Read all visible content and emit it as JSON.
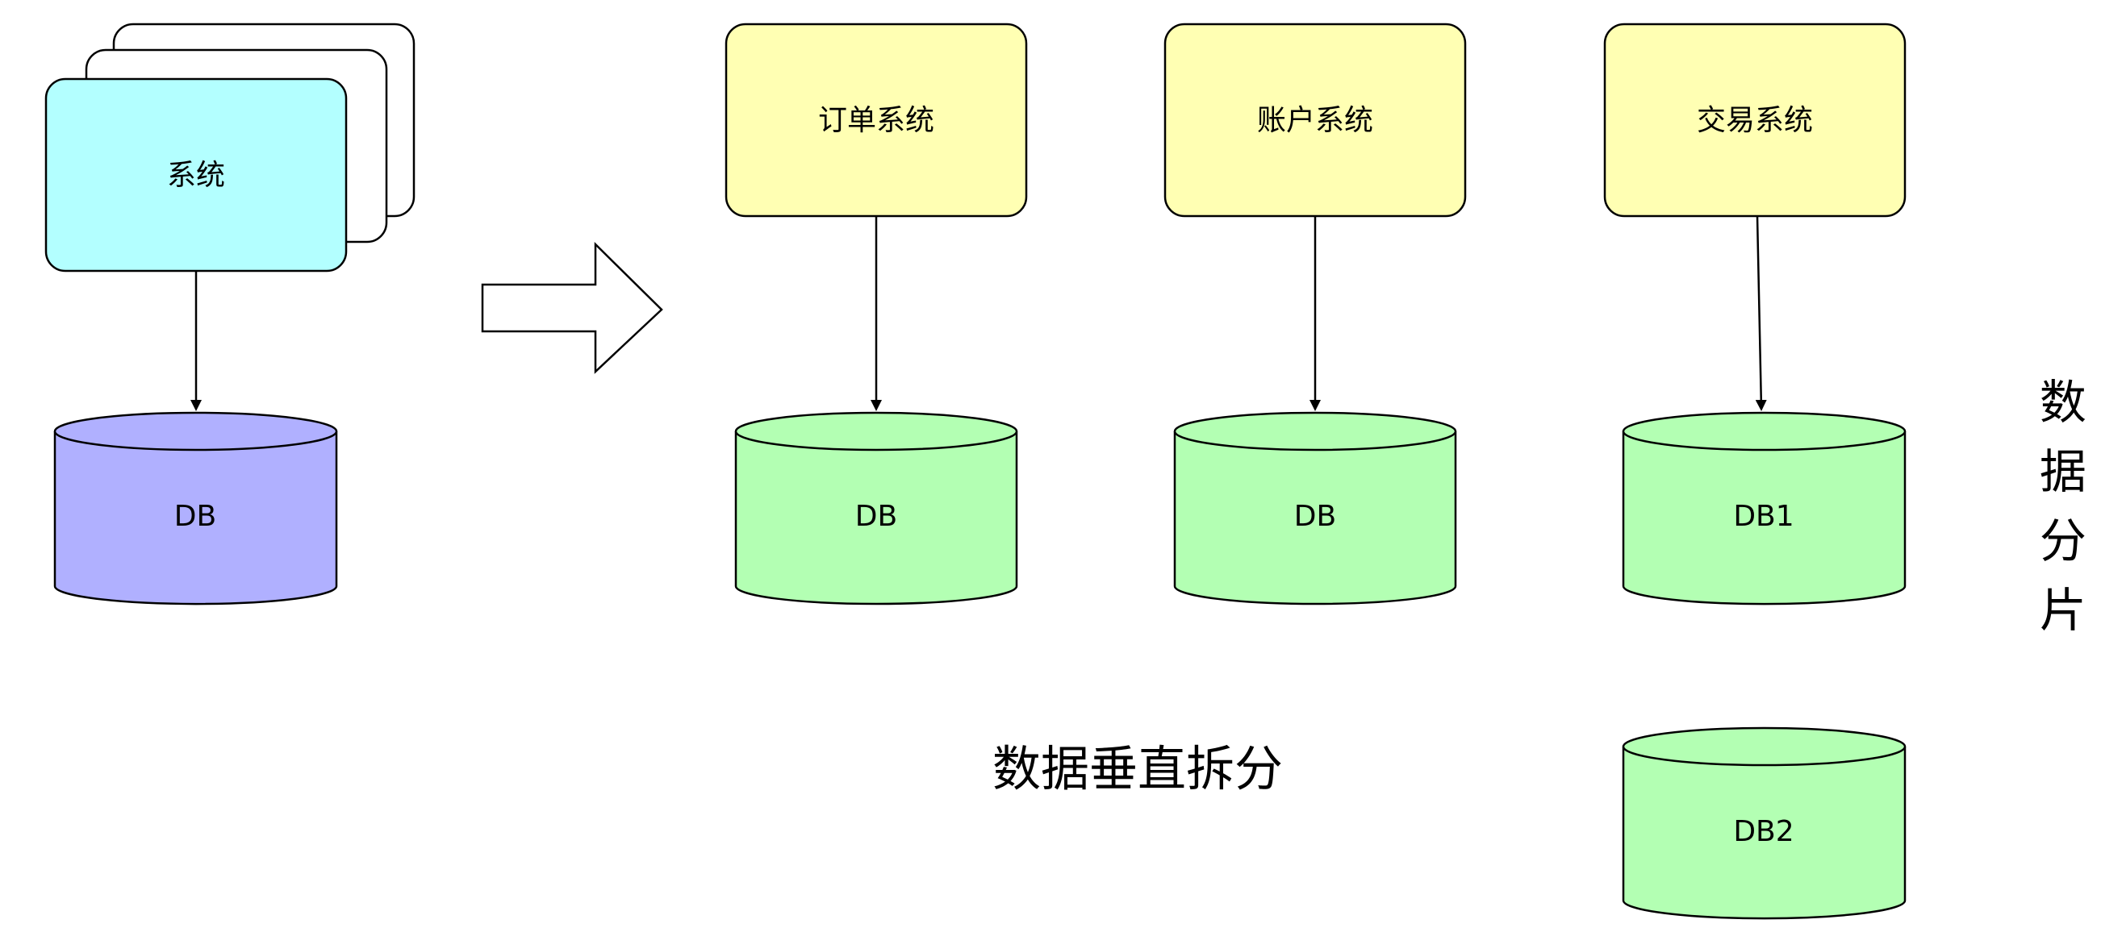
{
  "diagram": {
    "left_system": {
      "label": "系统",
      "stack_count": 3
    },
    "left_db": {
      "label": "DB"
    },
    "systems": [
      {
        "label": "订单系统"
      },
      {
        "label": "账户系统"
      },
      {
        "label": "交易系统"
      }
    ],
    "dbs": [
      {
        "label": "DB"
      },
      {
        "label": "DB"
      },
      {
        "label": "DB1"
      },
      {
        "label": "DB2"
      }
    ],
    "vertical_split_caption": "数据垂直拆分",
    "sharding_caption": "数据分片",
    "colors": {
      "left_system_fill": "#b3ffff",
      "left_db_fill": "#b0b0ff",
      "system_fill": "#ffffb3",
      "db_fill": "#b3ffb3",
      "stroke": "#000000"
    }
  }
}
